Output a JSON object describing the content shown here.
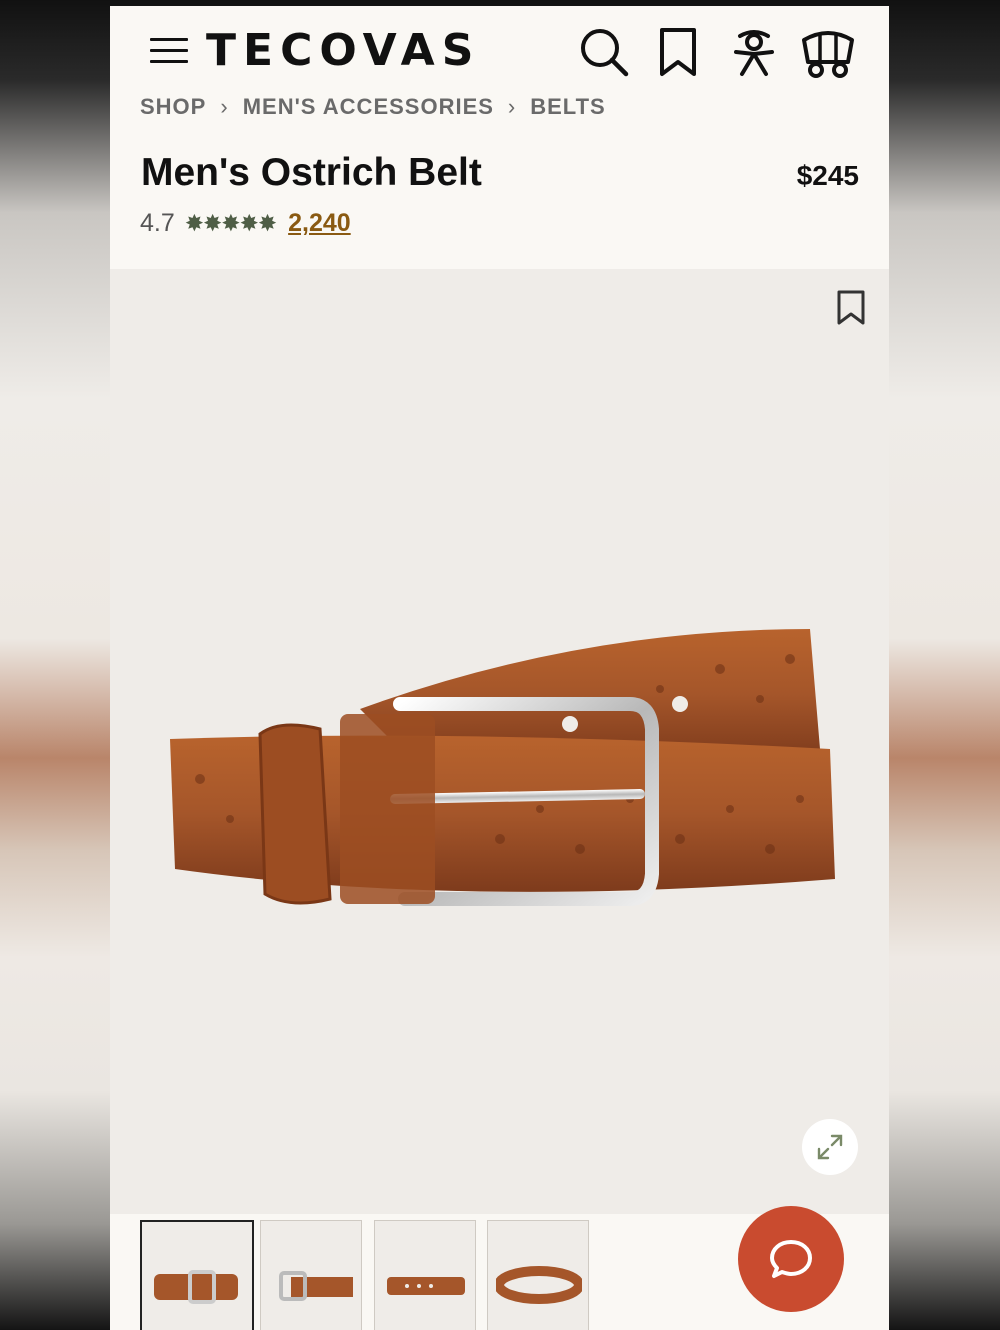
{
  "header": {
    "logo": "TECOVAS",
    "icons": [
      "menu-icon",
      "search-icon",
      "bookmark-icon",
      "account-icon",
      "cart-wagon-icon"
    ]
  },
  "breadcrumb": {
    "items": [
      "SHOP",
      "MEN'S ACCESSORIES",
      "BELTS"
    ],
    "separator": "›"
  },
  "product": {
    "title": "Men's Ostrich Belt",
    "price": "$245",
    "rating": "4.7",
    "stars": "✸✸✸✸✸",
    "review_count": "2,240"
  },
  "gallery": {
    "thumbnail_count": 4,
    "active_thumbnail": 1
  },
  "colors": {
    "accent_chat": "#c94b2f",
    "star_green": "#4f5e46",
    "review_link": "#8a5a12",
    "leather": "#a5562a"
  }
}
